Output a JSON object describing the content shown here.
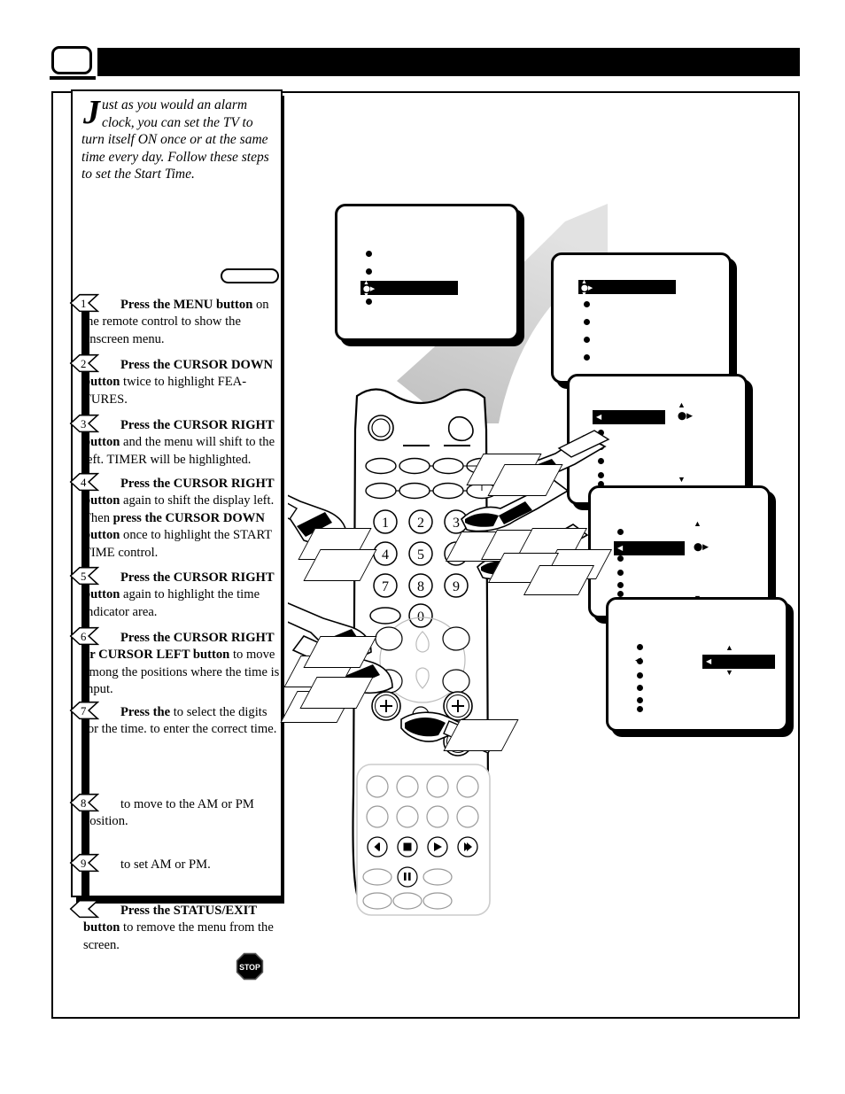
{
  "page": {
    "number": "",
    "header_title": ""
  },
  "intro": {
    "dropcap": "J",
    "text": "ust as you would an alarm clock, you can set the TV to turn itself ON once or at the same time every day. Follow these steps to set the Start Time."
  },
  "steps": [
    {
      "marker": "1",
      "segments": [
        {
          "text": "Press the MENU button",
          "bold": true
        },
        {
          "text": " on the remote control to show the onscreen menu.",
          "bold": false
        }
      ]
    },
    {
      "marker": "2",
      "segments": [
        {
          "text": "Press the CURSOR DOWN button",
          "bold": true
        },
        {
          "text": " twice to highlight FEA-TURES.",
          "bold": false
        }
      ]
    },
    {
      "marker": "3",
      "segments": [
        {
          "text": "Press the CURSOR RIGHT button",
          "bold": true
        },
        {
          "text": " and the menu will shift to the left. TIMER will be highlighted.",
          "bold": false
        }
      ]
    },
    {
      "marker": "4",
      "segments": [
        {
          "text": "Press the CURSOR RIGHT button",
          "bold": true
        },
        {
          "text": " again to shift the display left. Then ",
          "bold": false
        },
        {
          "text": "press the CURSOR DOWN button",
          "bold": true
        },
        {
          "text": " once to highlight the START TIME control.",
          "bold": false
        }
      ]
    },
    {
      "marker": "5",
      "segments": [
        {
          "text": "Press the CURSOR RIGHT button",
          "bold": true
        },
        {
          "text": " again to highlight the time indicator area.",
          "bold": false
        }
      ]
    },
    {
      "marker": "6",
      "segments": [
        {
          "text": "Press the CURSOR RIGHT or CURSOR LEFT button",
          "bold": true
        },
        {
          "text": " to move among the positions where the time is input.",
          "bold": false
        }
      ]
    },
    {
      "marker": "7",
      "segments": [
        {
          "text": "Press the",
          "bold": true
        },
        {
          "text": "",
          "bold": false
        },
        {
          "text": " to select the digits for the time.",
          "bold": false
        },
        {
          "text": "",
          "bold": false
        },
        {
          "text": " to enter the correct time.",
          "bold": false
        }
      ]
    },
    {
      "marker": "8",
      "segments": [
        {
          "text": "",
          "bold": false
        },
        {
          "text": " to move to the AM or PM position.",
          "bold": false
        }
      ]
    },
    {
      "marker": "9",
      "segments": [
        {
          "text": "",
          "bold": false
        },
        {
          "text": " to set AM or PM.",
          "bold": false
        }
      ]
    },
    {
      "marker": "",
      "segments": [
        {
          "text": "Press the STATUS/EXIT button",
          "bold": true
        },
        {
          "text": " to remove the menu from the screen.",
          "bold": false
        }
      ]
    }
  ],
  "stop_icon": {
    "label": "STOP"
  },
  "tv_screens": [
    {
      "name": "menu-screen-1",
      "bullets": 3,
      "highlight_index": 2,
      "highlight_icon": "cursor-updownright",
      "nav_arrows": false
    },
    {
      "name": "menu-screen-2",
      "bullets": 5,
      "highlight_index": 0,
      "highlight_icon": "cursor-updownright",
      "nav_arrows": false
    },
    {
      "name": "menu-screen-3",
      "bullets": 6,
      "highlight_index": 0,
      "highlight_icon": "cursor-left",
      "nav_arrows": true
    },
    {
      "name": "menu-screen-4",
      "bullets": 6,
      "highlight_index": 1,
      "highlight_icon": "cursor-left",
      "nav_arrows": true
    },
    {
      "name": "menu-screen-5",
      "bullets": 6,
      "highlight_index": 1,
      "highlight_icon": "cursor-left",
      "nav_arrows": true,
      "highlight_right": true
    }
  ],
  "remote": {
    "numeric_keys": [
      "1",
      "2",
      "3",
      "4",
      "5",
      "6",
      "7",
      "8",
      "9",
      "0"
    ],
    "transport_keys": [
      "rewind",
      "stop",
      "play",
      "fast-forward",
      "pause"
    ],
    "volume_plus": "+",
    "channel_plus": "+",
    "volume_minus": "−",
    "light_icon": "brightness-icon"
  },
  "colors": {
    "ink": "#000000",
    "paper": "#ffffff",
    "beam_gray": "#d9d9d9"
  }
}
